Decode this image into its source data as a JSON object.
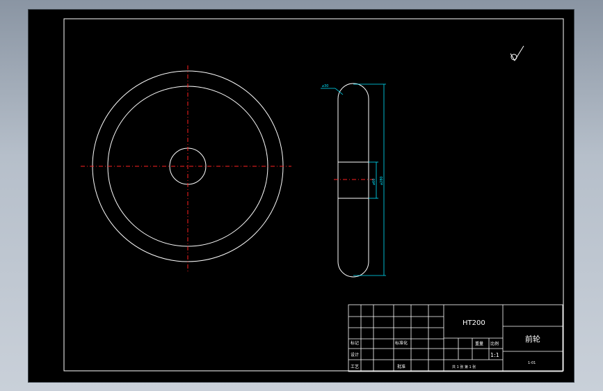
{
  "title_block": {
    "material": "HT200",
    "part_name": "前轮",
    "scale": "1:1",
    "scale_label": "比例",
    "weight_label": "重量",
    "drawing_no": "1-01",
    "sheet_info": "共 1 张  第 1 张",
    "row_labels": {
      "mark": "标记",
      "design": "设计",
      "standardize": "标准化",
      "process": "工艺",
      "approve": "批准"
    }
  },
  "dimensions": {
    "tire_section_dia": "⌀30",
    "hub_dia": "⌀60",
    "outer_dia": "⌀280"
  },
  "surface_finish_symbol": "check-mark-roughness-symbol"
}
